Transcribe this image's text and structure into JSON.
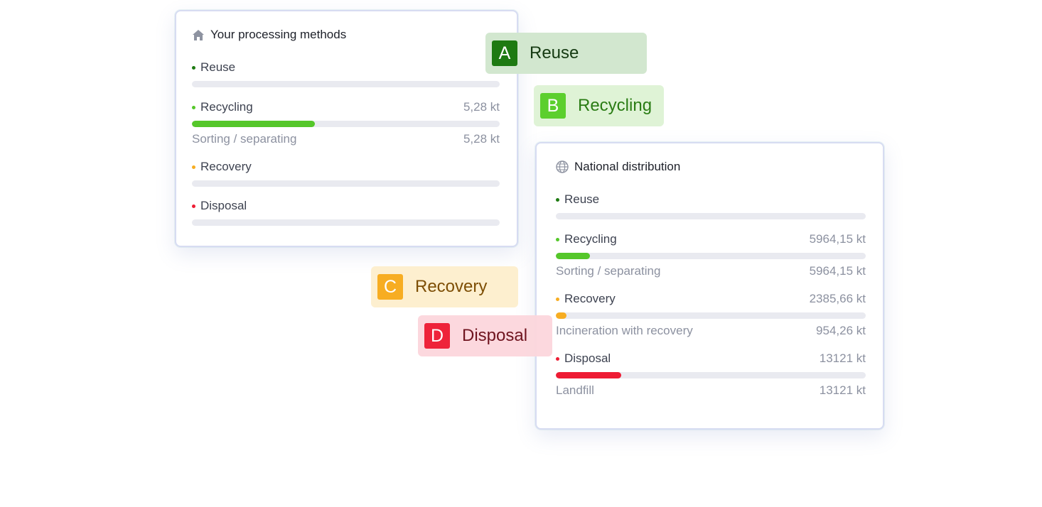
{
  "colors": {
    "reuse": "#1e7a12",
    "recycling": "#55c72a",
    "recovery": "#f7ad22",
    "disposal": "#ee1c34",
    "track": "#e9eaf0",
    "muted_text": "#8c91a0"
  },
  "local_card": {
    "icon": "home-icon",
    "title": "Your processing methods",
    "rows": [
      {
        "label": "Reuse",
        "value": "",
        "fill": 0
      },
      {
        "label": "Recycling",
        "value": "5,28 kt",
        "fill": 0.4,
        "sub_label": "Sorting / separating",
        "sub_value": "5,28 kt"
      },
      {
        "label": "Recovery",
        "value": "",
        "fill": 0
      },
      {
        "label": "Disposal",
        "value": "",
        "fill": 0
      }
    ]
  },
  "national_card": {
    "icon": "globe-icon",
    "title": "National distribution",
    "rows": [
      {
        "label": "Reuse",
        "value": "",
        "fill": 0
      },
      {
        "label": "Recycling",
        "value": "5964,15 kt",
        "fill": 0.11,
        "sub_label": "Sorting / separating",
        "sub_value": "5964,15 kt"
      },
      {
        "label": "Recovery",
        "value": "2385,66 kt",
        "fill": 0.035,
        "sub_label": "Incineration with recovery",
        "sub_value": "954,26 kt"
      },
      {
        "label": "Disposal",
        "value": "13121 kt",
        "fill": 0.21,
        "sub_label": "Landfill",
        "sub_value": "13121 kt"
      }
    ]
  },
  "tags": [
    {
      "letter": "A",
      "label": "Reuse"
    },
    {
      "letter": "B",
      "label": "Recycling"
    },
    {
      "letter": "C",
      "label": "Recovery"
    },
    {
      "letter": "D",
      "label": "Disposal"
    }
  ]
}
